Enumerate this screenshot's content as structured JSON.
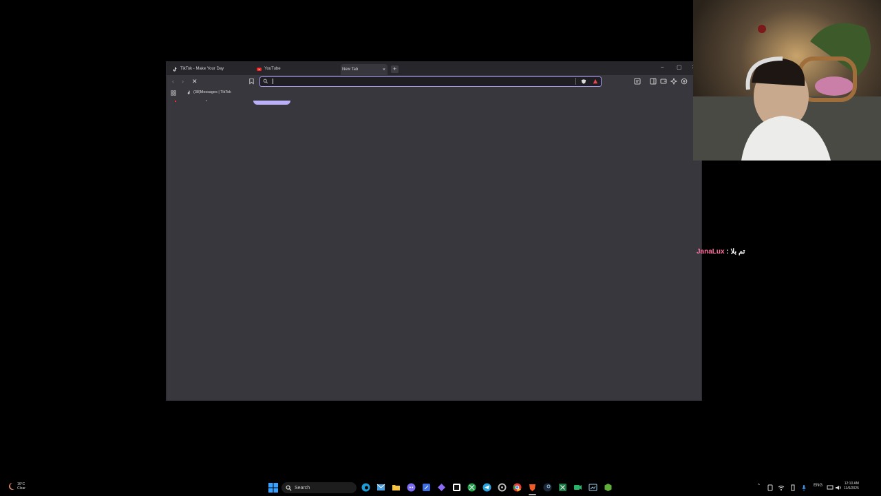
{
  "browser": {
    "tabs": [
      {
        "label": "TikTok - Make Your Day",
        "icon": "tiktok-icon"
      },
      {
        "label": "YouTube",
        "icon": "youtube-icon"
      },
      {
        "label": "New Tab",
        "icon": "",
        "active": true
      }
    ],
    "tab_close": "×",
    "new_tab": "+",
    "window_controls": {
      "minimize": "–",
      "maximize": "▢",
      "close": "✕"
    },
    "omnibox": {
      "value": "",
      "placeholder": ""
    },
    "bookmarks": [
      {
        "label": "(38)Messages | TikTok",
        "icon": "tiktok-icon"
      }
    ]
  },
  "chat": {
    "user": "JanaLux",
    "separator": " : ",
    "message": "تم بلا"
  },
  "taskbar": {
    "weather": {
      "temp": "16°C",
      "condition": "Clear"
    },
    "search_label": "Search",
    "language": "ENG",
    "time": "12:10 AM",
    "date": "11/6/2025"
  },
  "colors": {
    "accent": "#a89cf4",
    "window": "#38373d",
    "titlebar": "#27262b",
    "chat_user": "#ff6fa0"
  }
}
